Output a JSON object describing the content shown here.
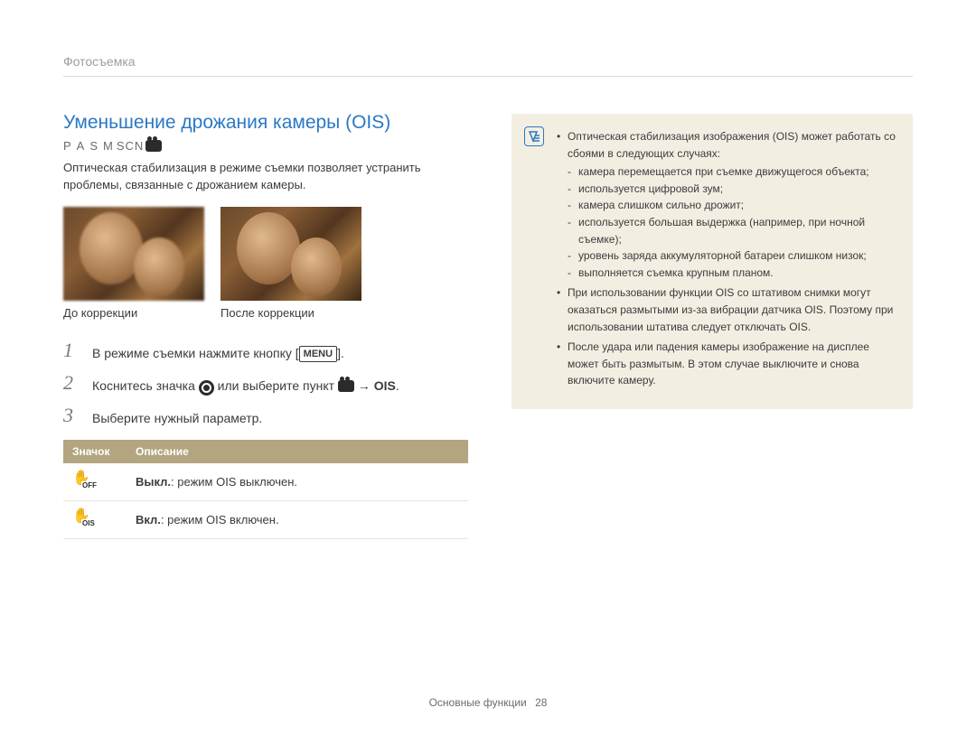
{
  "breadcrumb": "Фотосъемка",
  "title": "Уменьшение дрожания камеры (OIS)",
  "modes": {
    "p": "P",
    "a": "A",
    "s": "S",
    "m": "M",
    "scn": "SCN"
  },
  "intro": "Оптическая стабилизация в режиме съемки позволяет устранить проблемы, связанные с дрожанием камеры.",
  "examples": {
    "before": "До коррекции",
    "after": "После коррекции"
  },
  "steps": {
    "s1_a": "В режиме съемки нажмите кнопку [",
    "menu": "MENU",
    "s1_b": "].",
    "s2_a": "Коснитесь значка ",
    "s2_b": " или выберите пункт ",
    "s2_c": " → ",
    "s2_ois": "OIS",
    "s2_d": ".",
    "s3": "Выберите нужный параметр."
  },
  "table": {
    "head_icon": "Значок",
    "head_desc": "Описание",
    "rows": [
      {
        "sub": "OFF",
        "bold": "Выкл.",
        "rest": ": режим OIS выключен."
      },
      {
        "sub": "OIS",
        "bold": "Вкл.",
        "rest": ": режим OIS включен."
      }
    ]
  },
  "note": {
    "b1": "Оптическая стабилизация изображения (OIS) может работать со сбоями в следующих случаях:",
    "b1_items": [
      "камера перемещается при съемке движущегося объекта;",
      "используется цифровой зум;",
      "камера слишком сильно дрожит;",
      "используется большая выдержка (например, при ночной съемке);",
      "уровень заряда аккумуляторной батареи слишком низок;",
      "выполняется съемка крупным планом."
    ],
    "b2": "При использовании функции OIS со штативом снимки могут оказаться размытыми из-за вибрации датчика OIS. Поэтому при использовании штатива следует отключать OIS.",
    "b3": "После удара или падения камеры изображение на дисплее может быть размытым. В этом случае выключите и снова включите камеру."
  },
  "footer": {
    "label": "Основные функции",
    "page": "28"
  }
}
